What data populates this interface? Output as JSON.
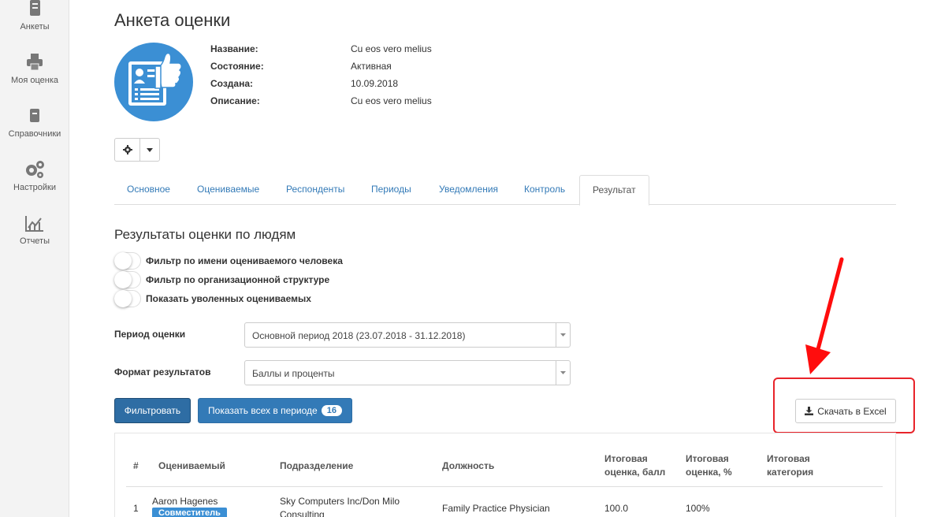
{
  "sidebar": {
    "items": [
      {
        "label": "Анкеты",
        "icon": "survey-icon"
      },
      {
        "label": "Моя оценка",
        "icon": "printer-icon"
      },
      {
        "label": "Справочники",
        "icon": "book-icon"
      },
      {
        "label": "Настройки",
        "icon": "gears-icon"
      },
      {
        "label": "Отчеты",
        "icon": "chart-icon"
      }
    ]
  },
  "header": {
    "title": "Анкета оценки",
    "fields": [
      {
        "label": "Название:",
        "value": "Cu eos vero melius"
      },
      {
        "label": "Состояние:",
        "value": "Активная"
      },
      {
        "label": "Создана:",
        "value": "10.09.2018"
      },
      {
        "label": "Описание:",
        "value": "Cu eos vero melius"
      }
    ]
  },
  "tabs": [
    {
      "label": "Основное"
    },
    {
      "label": "Оцениваемые"
    },
    {
      "label": "Респонденты"
    },
    {
      "label": "Периоды"
    },
    {
      "label": "Уведомления"
    },
    {
      "label": "Контроль"
    },
    {
      "label": "Результат",
      "active": true
    }
  ],
  "results": {
    "title": "Результаты оценки по людям",
    "toggles": [
      {
        "label": "Фильтр по имени оцениваемого человека",
        "on": false
      },
      {
        "label": "Фильтр по организационной структуре",
        "on": false
      },
      {
        "label": "Показать уволенных оцениваемых",
        "on": false
      }
    ],
    "period_label": "Период оценки",
    "period_value": "Основной период 2018 (23.07.2018 - 31.12.2018)",
    "format_label": "Формат результатов",
    "format_value": "Баллы и проценты",
    "filter_button": "Фильтровать",
    "show_all_button": "Показать всех в периоде",
    "show_all_count": "16",
    "excel_button": "Скачать в Excel"
  },
  "table": {
    "headers": {
      "num": "#",
      "person": "Оцениваемый",
      "department": "Подразделение",
      "position": "Должность",
      "score_line1": "Итоговая",
      "score_line2": "оценка, балл",
      "percent_line1": "Итоговая",
      "percent_line2": "оценка, %",
      "category_line1": "Итоговая",
      "category_line2": "категория"
    },
    "rows": [
      {
        "num": "1",
        "person": "Aaron Hagenes",
        "tag": "Совместитель",
        "department_line1": "Sky Computers Inc/Don Milo",
        "department_line2": "Consulting",
        "position": "Family Practice Physician",
        "score": "100.0",
        "percent": "100%",
        "category": ""
      }
    ]
  },
  "colors": {
    "accent": "#337ab7",
    "primary_dark": "#2e6da4",
    "highlight": "#e8232a",
    "avatar_bg": "#3b8fd4"
  }
}
